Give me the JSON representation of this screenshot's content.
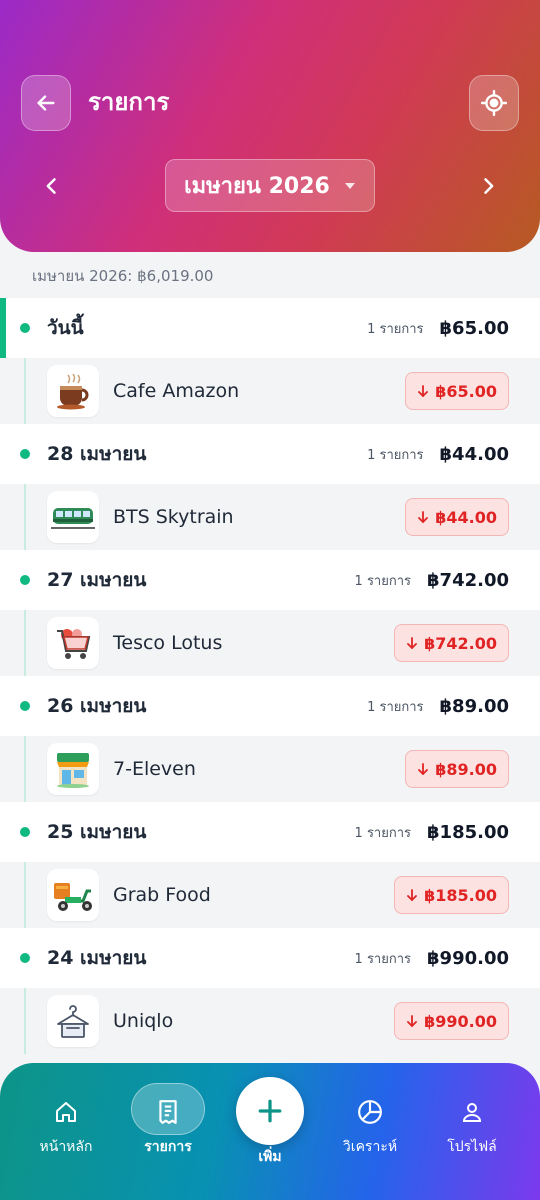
{
  "header": {
    "title": "รายการ",
    "month": "เมษายน 2026",
    "back_icon": "arrow-left-icon",
    "target_icon": "crosshair-icon"
  },
  "summary": "เมษายน 2026: ฿6,019.00",
  "days": [
    {
      "label": "วันนี้",
      "count": "1 รายการ",
      "total": "฿65.00",
      "today": true,
      "tx": {
        "name": "Cafe Amazon",
        "amount": "฿65.00",
        "icon": "coffee-cup-icon"
      }
    },
    {
      "label": "28 เมษายน",
      "count": "1 รายการ",
      "total": "฿44.00",
      "tx": {
        "name": "BTS Skytrain",
        "amount": "฿44.00",
        "icon": "train-icon"
      }
    },
    {
      "label": "27 เมษายน",
      "count": "1 รายการ",
      "total": "฿742.00",
      "tx": {
        "name": "Tesco Lotus",
        "amount": "฿742.00",
        "icon": "shopping-cart-icon"
      }
    },
    {
      "label": "26 เมษายน",
      "count": "1 รายการ",
      "total": "฿89.00",
      "tx": {
        "name": "7-Eleven",
        "amount": "฿89.00",
        "icon": "store-icon"
      }
    },
    {
      "label": "25 เมษายน",
      "count": "1 รายการ",
      "total": "฿185.00",
      "tx": {
        "name": "Grab Food",
        "amount": "฿185.00",
        "icon": "delivery-scooter-icon"
      }
    },
    {
      "label": "24 เมษายน",
      "count": "1 รายการ",
      "total": "฿990.00",
      "tx": {
        "name": "Uniqlo",
        "amount": "฿990.00",
        "icon": "hanger-icon"
      }
    }
  ],
  "nav": {
    "home": "หน้าหลัก",
    "transactions": "รายการ",
    "add": "เพิ่ม",
    "analytics": "วิเคราะห์",
    "profile": "โปรไฟล์"
  },
  "colors": {
    "accent_green": "#10b981",
    "expense_red": "#e02424"
  }
}
